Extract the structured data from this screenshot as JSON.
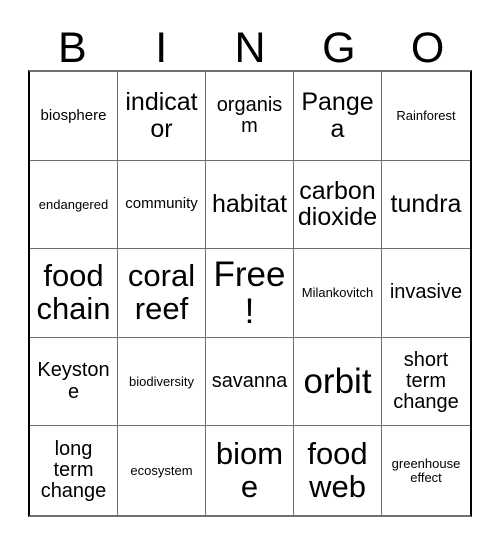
{
  "card": {
    "title": "BINGO",
    "header_letters": [
      "B",
      "I",
      "N",
      "G",
      "O"
    ],
    "colors": {
      "background": "#ffffff",
      "text": "#000000",
      "inner_border": "#6e6e6e",
      "outer_border": "#000000"
    },
    "grid_size": "5x5",
    "free_space": "Free!",
    "cells": [
      {
        "text": "biosphere",
        "size": "sz-s"
      },
      {
        "text": "indicator",
        "size": "sz-l"
      },
      {
        "text": "organism",
        "size": "sz-m"
      },
      {
        "text": "Pangea",
        "size": "sz-l"
      },
      {
        "text": "Rainforest",
        "size": "sz-xs"
      },
      {
        "text": "endangered",
        "size": "sz-xs"
      },
      {
        "text": "community",
        "size": "sz-s"
      },
      {
        "text": "habitat",
        "size": "sz-l"
      },
      {
        "text": "carbon dioxide",
        "size": "sz-l"
      },
      {
        "text": "tundra",
        "size": "sz-l"
      },
      {
        "text": "food chain",
        "size": "sz-xl"
      },
      {
        "text": "coral reef",
        "size": "sz-xl"
      },
      {
        "text": "Free!",
        "size": "sz-xxl"
      },
      {
        "text": "Milankovitch",
        "size": "sz-xs"
      },
      {
        "text": "invasive",
        "size": "sz-m"
      },
      {
        "text": "Keystone",
        "size": "sz-m"
      },
      {
        "text": "biodiversity",
        "size": "sz-xs"
      },
      {
        "text": "savanna",
        "size": "sz-m"
      },
      {
        "text": "orbit",
        "size": "sz-xxl"
      },
      {
        "text": "short term change",
        "size": "sz-m"
      },
      {
        "text": "long term change",
        "size": "sz-m"
      },
      {
        "text": "ecosystem",
        "size": "sz-xs"
      },
      {
        "text": "biome",
        "size": "sz-xl"
      },
      {
        "text": "food web",
        "size": "sz-xl"
      },
      {
        "text": "greenhouse effect",
        "size": "sz-xs"
      }
    ]
  }
}
